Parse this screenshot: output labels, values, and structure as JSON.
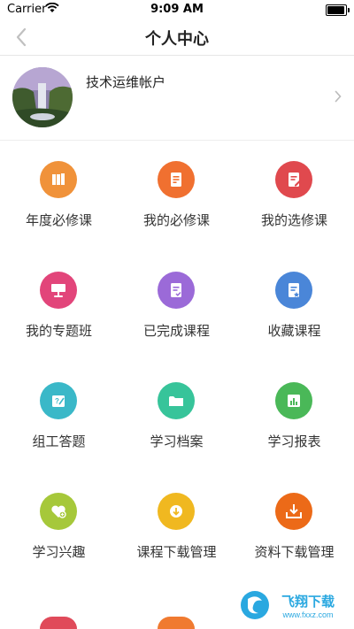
{
  "status_bar": {
    "carrier": "Carrier",
    "time": "9:09 AM",
    "battery_level": 0.95
  },
  "nav": {
    "title": "个人中心",
    "back_icon": "chevron-left-icon"
  },
  "profile": {
    "name": "技术运维帐户",
    "avatar": "waterfall-photo",
    "chevron_icon": "chevron-right-icon"
  },
  "menu": [
    {
      "label": "年度必修课",
      "icon": "books-icon",
      "color": "#f0923a"
    },
    {
      "label": "我的必修课",
      "icon": "document-icon",
      "color": "#f07030"
    },
    {
      "label": "我的选修课",
      "icon": "edit-document-icon",
      "color": "#e0494e"
    },
    {
      "label": "我的专题班",
      "icon": "lectern-icon",
      "color": "#e2457a"
    },
    {
      "label": "已完成课程",
      "icon": "checklist-icon",
      "color": "#9b6ad8"
    },
    {
      "label": "收藏课程",
      "icon": "starred-document-icon",
      "color": "#4a86d8"
    },
    {
      "label": "组工答题",
      "icon": "question-card-icon",
      "color": "#3ab8c8"
    },
    {
      "label": "学习档案",
      "icon": "folder-icon",
      "color": "#37c49a"
    },
    {
      "label": "学习报表",
      "icon": "bar-chart-icon",
      "color": "#4ab858"
    },
    {
      "label": "学习兴趣",
      "icon": "heart-plus-icon",
      "color": "#a6c83a"
    },
    {
      "label": "课程下载管理",
      "icon": "download-circle-icon",
      "color": "#f0b820"
    },
    {
      "label": "资料下载管理",
      "icon": "download-tray-icon",
      "color": "#ec6a18"
    }
  ],
  "watermark": {
    "text": "飞翔下载",
    "url": "www.fxxz.com"
  }
}
